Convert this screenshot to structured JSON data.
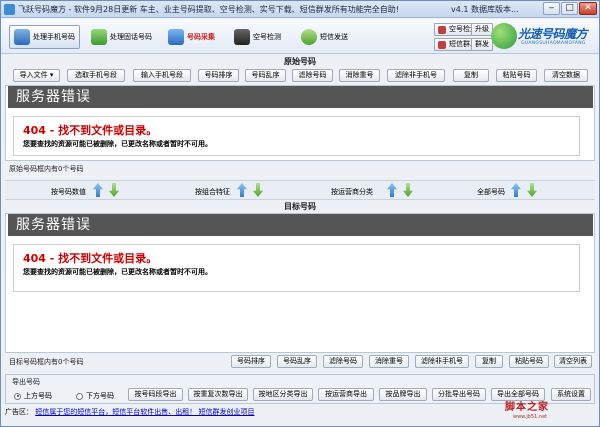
{
  "window": {
    "title": "飞跃号码魔方 - 软件9月28日更新  车主、业主号码提取、空号检测、实号下载、短信群发所有功能完全自助!",
    "version": "v4.1 数据库版本..."
  },
  "toolbar": {
    "tabs": [
      "处理手机号码",
      "处理固话号码",
      "号码采集",
      "空号检测",
      "短信发送"
    ],
    "side_buttons": [
      "空号检测",
      "短信群发",
      "升级",
      "群发"
    ],
    "brand": "光速号码魔方",
    "brand_sub": "GUANGSUHAOMAMOFANG"
  },
  "source": {
    "title": "原始号码",
    "buttons": [
      "导入文件",
      "选取手机号段",
      "输入手机号段",
      "号码排序",
      "号码乱序",
      "滤除号码",
      "消除重号",
      "滤除非手机号",
      "复制",
      "粘贴号码",
      "清空数据"
    ],
    "error_band": "服务器错误",
    "error_title": "404 - 找不到文件或目录。",
    "error_text": "您要查找的资源可能已被删除，已更改名称或者暂时不可用。",
    "count_text": "原始号码框内有0个号码"
  },
  "sort": {
    "labels": [
      "按号码数值",
      "按组合特征",
      "按运营商分类",
      "全部号码"
    ]
  },
  "target": {
    "title": "目标号码",
    "error_band": "服务器错误",
    "error_title": "404 - 找不到文件或目录。",
    "error_text": "您要查找的资源可能已被删除，已更改名称或者暂时不可用。",
    "count_text": "目标号码框内有0个号码",
    "buttons": [
      "号码排序",
      "号码乱序",
      "滤除号码",
      "消除重号",
      "滤除非手机号",
      "复制",
      "粘贴号码",
      "清空列表"
    ]
  },
  "export": {
    "legend": "导出号码",
    "radios": [
      "上方号码",
      "下方号码"
    ],
    "selected": "上方号码",
    "buttons": [
      "按号码段导出",
      "按重复次数导出",
      "按地区分类导出",
      "按运营商导出",
      "按品牌导出",
      "分批导出号码",
      "导出全部号码",
      "系统设置"
    ]
  },
  "adbar": {
    "label": "广告区",
    "link": "短信属于您的短信平台，短信平台软件出售、出租！ 短信群发创业项目"
  },
  "watermark": {
    "main": "脚本之家",
    "sub": "www.jb51.net"
  },
  "colors": {
    "error_red": "#cc0000",
    "band": "#555555",
    "accent": "#1660b4"
  }
}
